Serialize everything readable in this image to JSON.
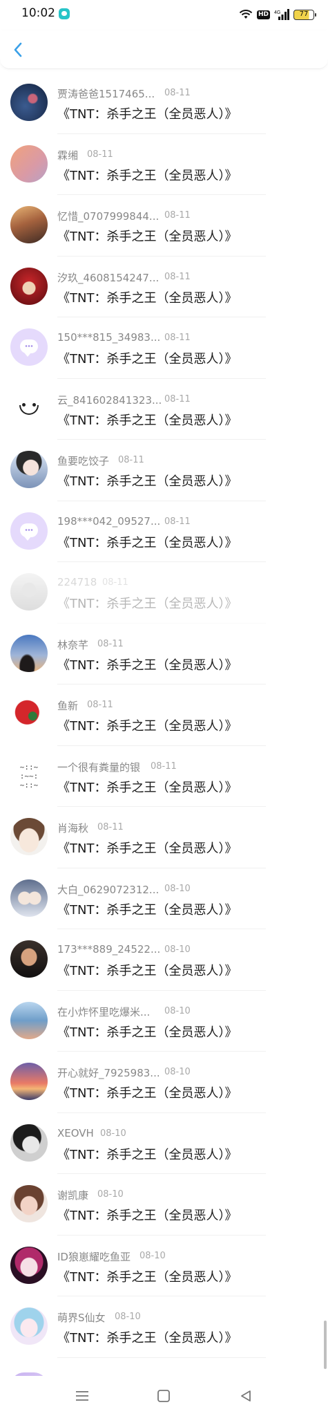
{
  "status_bar": {
    "time": "10:02",
    "hd_label": "HD",
    "signal_label": "4G",
    "battery": "77",
    "battery_level": 0.77
  },
  "header": {
    "back_icon": "chevron-left-icon",
    "accent_color": "#3aa0e8"
  },
  "list_items": [
    {
      "name": "贾涛爸爸1517465...",
      "date": "08-11",
      "title": "《TNT：杀手之王（全员恶人）》",
      "avatar": "blue-night-photo"
    },
    {
      "name": "霖缃",
      "date": "08-11",
      "title": "《TNT：杀手之王（全员恶人）》",
      "avatar": "pink-orange-gradient"
    },
    {
      "name": "忆惜_0707999844...",
      "date": "08-11",
      "title": "《TNT：杀手之王（全员恶人）》",
      "avatar": "couple-photo"
    },
    {
      "name": "汐玖_4608154247...",
      "date": "08-11",
      "title": "《TNT：杀手之王（全员恶人）》",
      "avatar": "red-anime"
    },
    {
      "name": "150***815_34983...",
      "date": "08-11",
      "title": "《TNT：杀手之王（全员恶人）》",
      "avatar": "default-chat-icon"
    },
    {
      "name": "云_841602841323...",
      "date": "08-11",
      "title": "《TNT：杀手之王（全员恶人）》",
      "avatar": "smiley-face"
    },
    {
      "name": "鱼要吃饺子",
      "date": "08-11",
      "title": "《TNT：杀手之王（全员恶人）》",
      "avatar": "girl-portrait"
    },
    {
      "name": "198***042_09527...",
      "date": "08-11",
      "title": "《TNT：杀手之王（全员恶人）》",
      "avatar": "default-chat-icon"
    },
    {
      "name": "224718",
      "date": "08-11",
      "title": "《TNT：杀手之王（全员恶人）》",
      "avatar": "faded-photo",
      "faded": true
    },
    {
      "name": "林奈芊",
      "date": "08-11",
      "title": "《TNT：杀手之王（全员恶人）》",
      "avatar": "sky-silhouette"
    },
    {
      "name": "鱼新",
      "date": "08-11",
      "title": "《TNT：杀手之王（全员恶人）》",
      "avatar": "cartoon-sticker"
    },
    {
      "name": "一个很有粪量的银",
      "date": "08-11",
      "title": "《TNT：杀手之王（全员恶人）》",
      "avatar": "doodle-text"
    },
    {
      "name": "肖海秋",
      "date": "08-11",
      "title": "《TNT：杀手之王（全员恶人）》",
      "avatar": "anime-boy"
    },
    {
      "name": "大白_0629072312...",
      "date": "08-10",
      "title": "《TNT：杀手之王（全员恶人）》",
      "avatar": "anime-couple"
    },
    {
      "name": "173***889_24522...",
      "date": "08-10",
      "title": "《TNT：杀手之王（全员恶人）》",
      "avatar": "man-portrait"
    },
    {
      "name": "在小炸怀里吃爆米...",
      "date": "08-10",
      "title": "《TNT：杀手之王（全员恶人）》",
      "avatar": "group-photo"
    },
    {
      "name": "开心就好_7925983...",
      "date": "08-10",
      "title": "《TNT：杀手之王（全员恶人）》",
      "avatar": "sunset-photo"
    },
    {
      "name": "XEOVH",
      "date": "08-10",
      "title": "《TNT：杀手之王（全员恶人）》",
      "avatar": "sketch-portrait"
    },
    {
      "name": "谢凯康",
      "date": "08-10",
      "title": "《TNT：杀手之王（全员恶人）》",
      "avatar": "woman-portrait"
    },
    {
      "name": "ID狼崽耀吃鱼亚",
      "date": "08-10",
      "title": "《TNT：杀手之王（全员恶人）》",
      "avatar": "purple-anime"
    },
    {
      "name": "萌界S仙女",
      "date": "08-10",
      "title": "《TNT：杀手之王（全员恶人）》",
      "avatar": "pastel-anime"
    }
  ],
  "nav_bar": {
    "menu_icon": "menu-icon",
    "home_icon": "home-square-icon",
    "back_icon": "triangle-back-icon"
  }
}
